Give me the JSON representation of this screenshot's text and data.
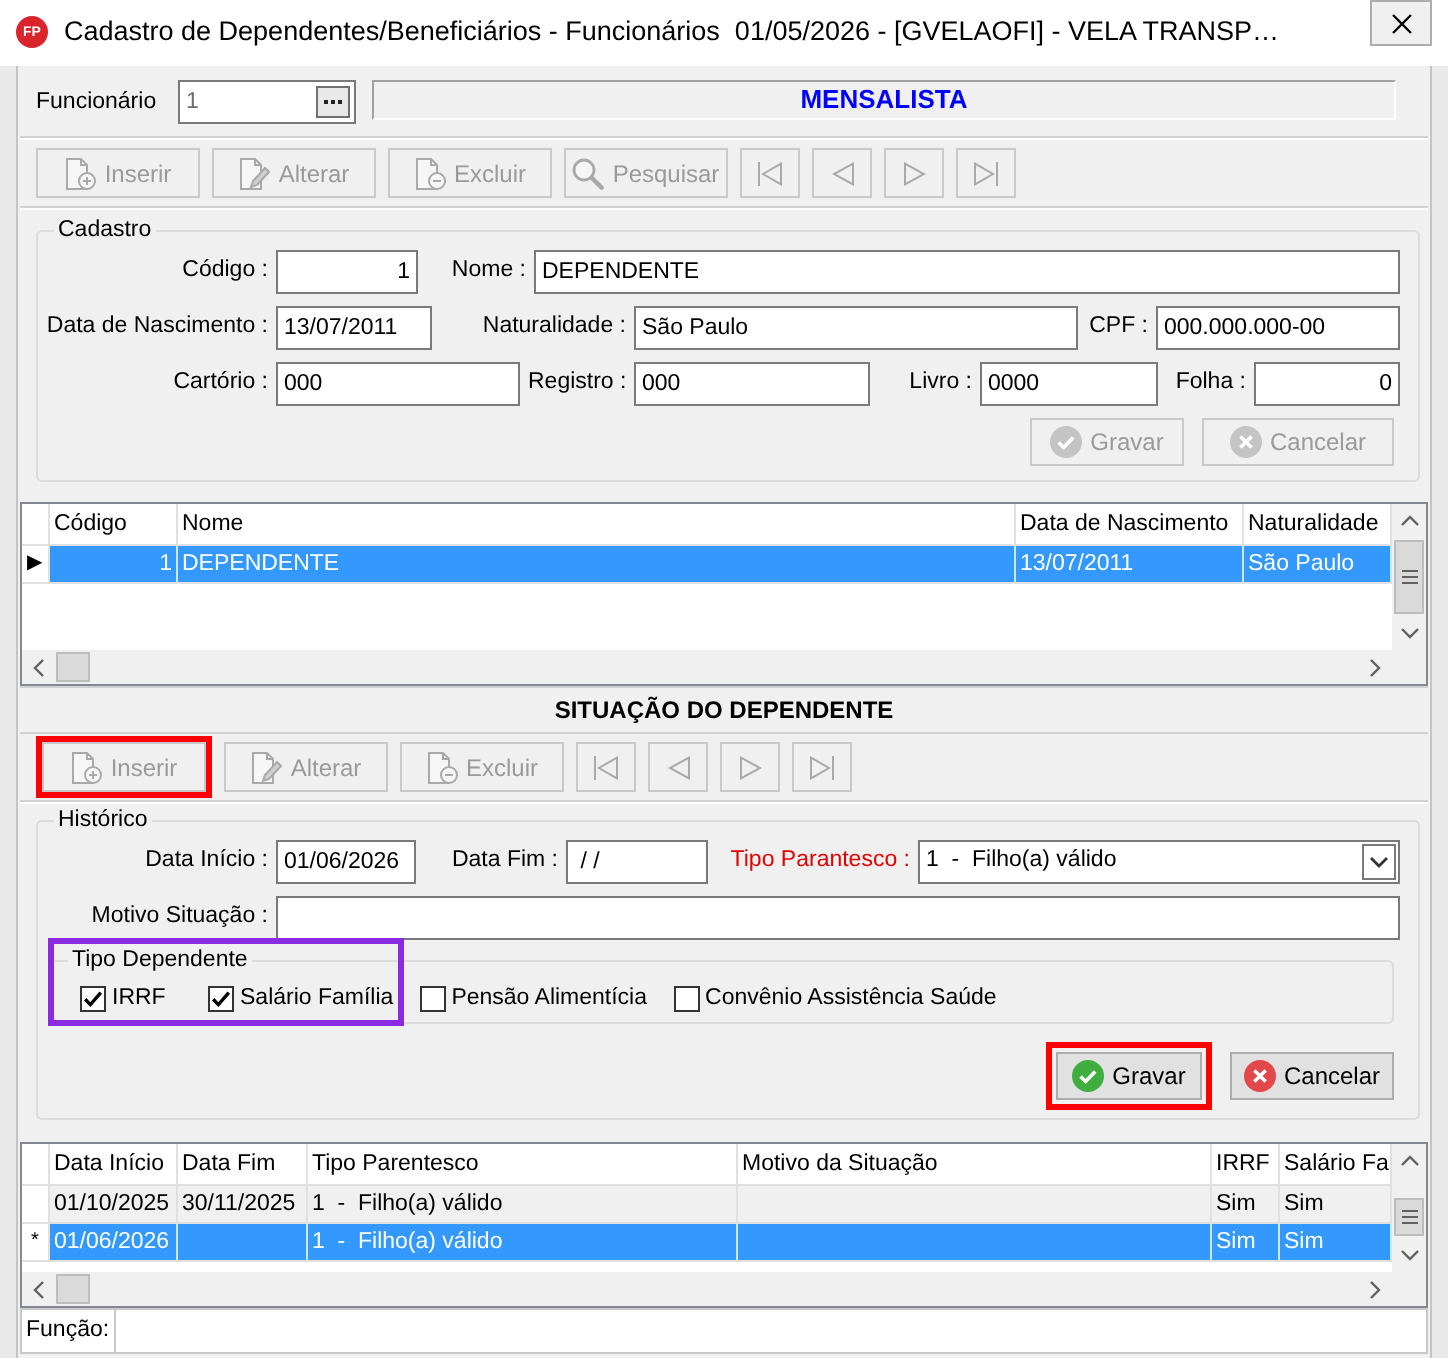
{
  "window": {
    "logo": "FP",
    "title": "Cadastro de Dependentes/Beneficiários - Funcionários  01/05/2026 - [GVELAOFI] - VELA TRANSP…"
  },
  "employee": {
    "label": "Funcionário",
    "value": "1",
    "disabled": true,
    "category": "MENSALISTA"
  },
  "toolbar": [
    {
      "kind": "insert",
      "label": "Inserir",
      "disabled": true
    },
    {
      "kind": "edit",
      "label": "Alterar",
      "disabled": true
    },
    {
      "kind": "delete",
      "label": "Excluir",
      "disabled": true
    },
    {
      "kind": "search",
      "label": "Pesquisar",
      "disabled": true
    },
    {
      "kind": "first",
      "disabled": true
    },
    {
      "kind": "prev",
      "disabled": true
    },
    {
      "kind": "next",
      "disabled": true
    },
    {
      "kind": "last",
      "disabled": true
    }
  ],
  "cadastro": {
    "title": "Cadastro",
    "rows": [
      {
        "fields": [
          {
            "label": "Código :",
            "value": "1",
            "kind": "number"
          },
          {
            "label": "Nome :",
            "value": "DEPENDENTE",
            "kind": "text"
          }
        ]
      },
      {
        "fields": [
          {
            "label": "Data de Nascimento :",
            "value": "13/07/2011",
            "kind": "text"
          },
          {
            "label": "Naturalidade :",
            "value": "São Paulo",
            "kind": "text"
          },
          {
            "label": "CPF :",
            "value": "000.000.000-00",
            "kind": "text"
          }
        ]
      },
      {
        "fields": [
          {
            "label": "Cartório :",
            "value": "000",
            "kind": "text"
          },
          {
            "label": "Registro :",
            "value": "000",
            "kind": "text"
          },
          {
            "label": "Livro :",
            "value": "0000",
            "kind": "text"
          },
          {
            "label": "Folha :",
            "value": "0",
            "kind": "number"
          }
        ]
      }
    ],
    "buttons": [
      {
        "kind": "save",
        "label": "Gravar",
        "disabled": true
      },
      {
        "kind": "cancel",
        "label": "Cancelar",
        "disabled": true
      }
    ]
  },
  "dependents_grid": {
    "columns": [
      {
        "label": "Código",
        "kind": "number"
      },
      {
        "label": "Nome",
        "kind": "text"
      },
      {
        "label": "Data de Nascimento",
        "kind": "text"
      },
      {
        "label": "Naturalidade",
        "kind": "text"
      }
    ],
    "rows": [
      {
        "indicator": "▶",
        "selected": true,
        "cells": [
          "1",
          "DEPENDENTE",
          "13/07/2011",
          "São Paulo"
        ]
      }
    ]
  },
  "situation": {
    "title": "SITUAÇÃO DO DEPENDENTE",
    "toolbar": [
      {
        "kind": "insert",
        "label": "Inserir",
        "disabled": true,
        "highlight": {
          "color": "#ff0000"
        }
      },
      {
        "kind": "edit",
        "label": "Alterar",
        "disabled": true
      },
      {
        "kind": "delete",
        "label": "Excluir",
        "disabled": true
      },
      {
        "kind": "first",
        "disabled": true
      },
      {
        "kind": "prev",
        "disabled": true
      },
      {
        "kind": "next",
        "disabled": true
      },
      {
        "kind": "last",
        "disabled": true
      }
    ],
    "history": {
      "title": "Histórico",
      "rows": [
        {
          "fields": [
            {
              "label": "Data Início :",
              "value": "01/06/2026",
              "kind": "text",
              "required": false
            },
            {
              "label": "Data Fim :",
              "value": " / /",
              "kind": "text",
              "required": false
            },
            {
              "label": "Tipo Parantesco :",
              "value": "1  -  Filho(a) válido",
              "kind": "dropdown",
              "required": true
            }
          ]
        },
        {
          "fields": [
            {
              "label": "Motivo Situação :",
              "kind": "text",
              "required": false
            }
          ]
        }
      ],
      "dependent_type": {
        "title": "Tipo Dependente",
        "highlight": {
          "color": "#8a2be2"
        },
        "options": [
          {
            "label": "IRRF",
            "checked": true,
            "highlighted": true
          },
          {
            "label": "Salário Família",
            "checked": true,
            "highlighted": true
          },
          {
            "label": "Pensão Alimentícia",
            "checked": false,
            "highlighted": false
          },
          {
            "label": "Convênio Assistência Saúde",
            "checked": false,
            "highlighted": false
          }
        ]
      },
      "buttons": [
        {
          "kind": "save",
          "label": "Gravar",
          "disabled": false,
          "highlight": {
            "color": "#ff0000"
          }
        },
        {
          "kind": "cancel",
          "label": "Cancelar",
          "disabled": false
        }
      ]
    },
    "grid": {
      "columns": [
        {
          "label": "Data Início"
        },
        {
          "label": "Data Fim"
        },
        {
          "label": "Tipo Parentesco"
        },
        {
          "label": "Motivo da Situação"
        },
        {
          "label": "IRRF"
        },
        {
          "label": "Salário Fa"
        }
      ],
      "rows": [
        {
          "selected": false,
          "cells": [
            "01/10/2025",
            "30/11/2025",
            "1  -  Filho(a) válido",
            null,
            "Sim",
            "Sim"
          ]
        },
        {
          "indicator": "*",
          "selected": true,
          "cells": [
            "01/06/2026",
            null,
            "1  -  Filho(a) válido",
            null,
            "Sim",
            "Sim"
          ]
        }
      ]
    }
  },
  "status_bar": {
    "label": "Função:"
  }
}
